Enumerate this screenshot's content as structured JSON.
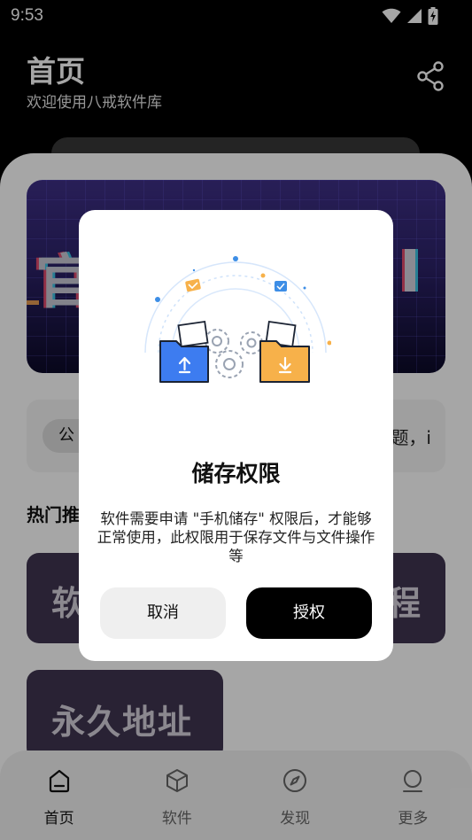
{
  "status_bar": {
    "time": "9:53"
  },
  "header": {
    "title": "首页",
    "subtitle": "欢迎使用八戒软件库"
  },
  "banner": {
    "left_text": "官",
    "right_text": "址"
  },
  "notice": {
    "chip_label": "公",
    "text_visible": "题，i"
  },
  "section": {
    "title": "热门推"
  },
  "cards": [
    {
      "label_left": "软",
      "label_right": "程"
    },
    {
      "label": "永久地址"
    }
  ],
  "bottom_nav": [
    {
      "label": "首页",
      "icon": "home-icon"
    },
    {
      "label": "软件",
      "icon": "cube-icon"
    },
    {
      "label": "发现",
      "icon": "compass-icon"
    },
    {
      "label": "更多",
      "icon": "more-icon"
    }
  ],
  "dialog": {
    "title": "储存权限",
    "message": "软件需要申请 \"手机储存\" 权限后，才能够正常使用，此权限用于保存文件与文件操作等",
    "cancel_label": "取消",
    "grant_label": "授权"
  },
  "colors": {
    "accent_dark": "#000000",
    "upload_folder": "#3d7cf0",
    "download_folder": "#f7b14a",
    "card_bg": "#3f3550"
  }
}
